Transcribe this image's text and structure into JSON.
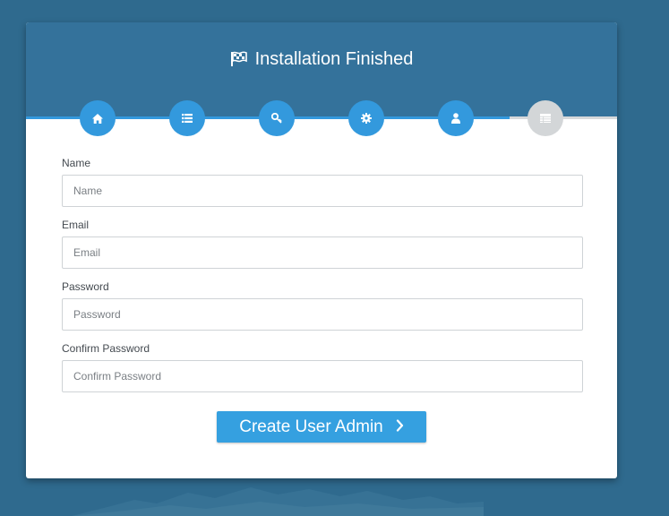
{
  "header": {
    "title": "Installation Finished",
    "title_icon": "flag-icon",
    "background_color": "#34729b"
  },
  "steps": [
    {
      "icon": "home-icon",
      "status": "done"
    },
    {
      "icon": "list-icon",
      "status": "done"
    },
    {
      "icon": "key-icon",
      "status": "done"
    },
    {
      "icon": "gear-icon",
      "status": "done"
    },
    {
      "icon": "user-icon",
      "status": "done"
    },
    {
      "icon": "table-icon",
      "status": "pending"
    }
  ],
  "colors": {
    "step_done": "#3399dd",
    "step_pending": "#d3d6d8",
    "button": "#35a0e0",
    "page_background": "#2f6a8e"
  },
  "form": {
    "name": {
      "label": "Name",
      "placeholder": "Name",
      "value": ""
    },
    "email": {
      "label": "Email",
      "placeholder": "Email",
      "value": ""
    },
    "password": {
      "label": "Password",
      "placeholder": "Password",
      "value": ""
    },
    "confirm_password": {
      "label": "Confirm Password",
      "placeholder": "Confirm Password",
      "value": ""
    },
    "submit_label": "Create User Admin",
    "submit_icon": "chevron-right-icon"
  }
}
